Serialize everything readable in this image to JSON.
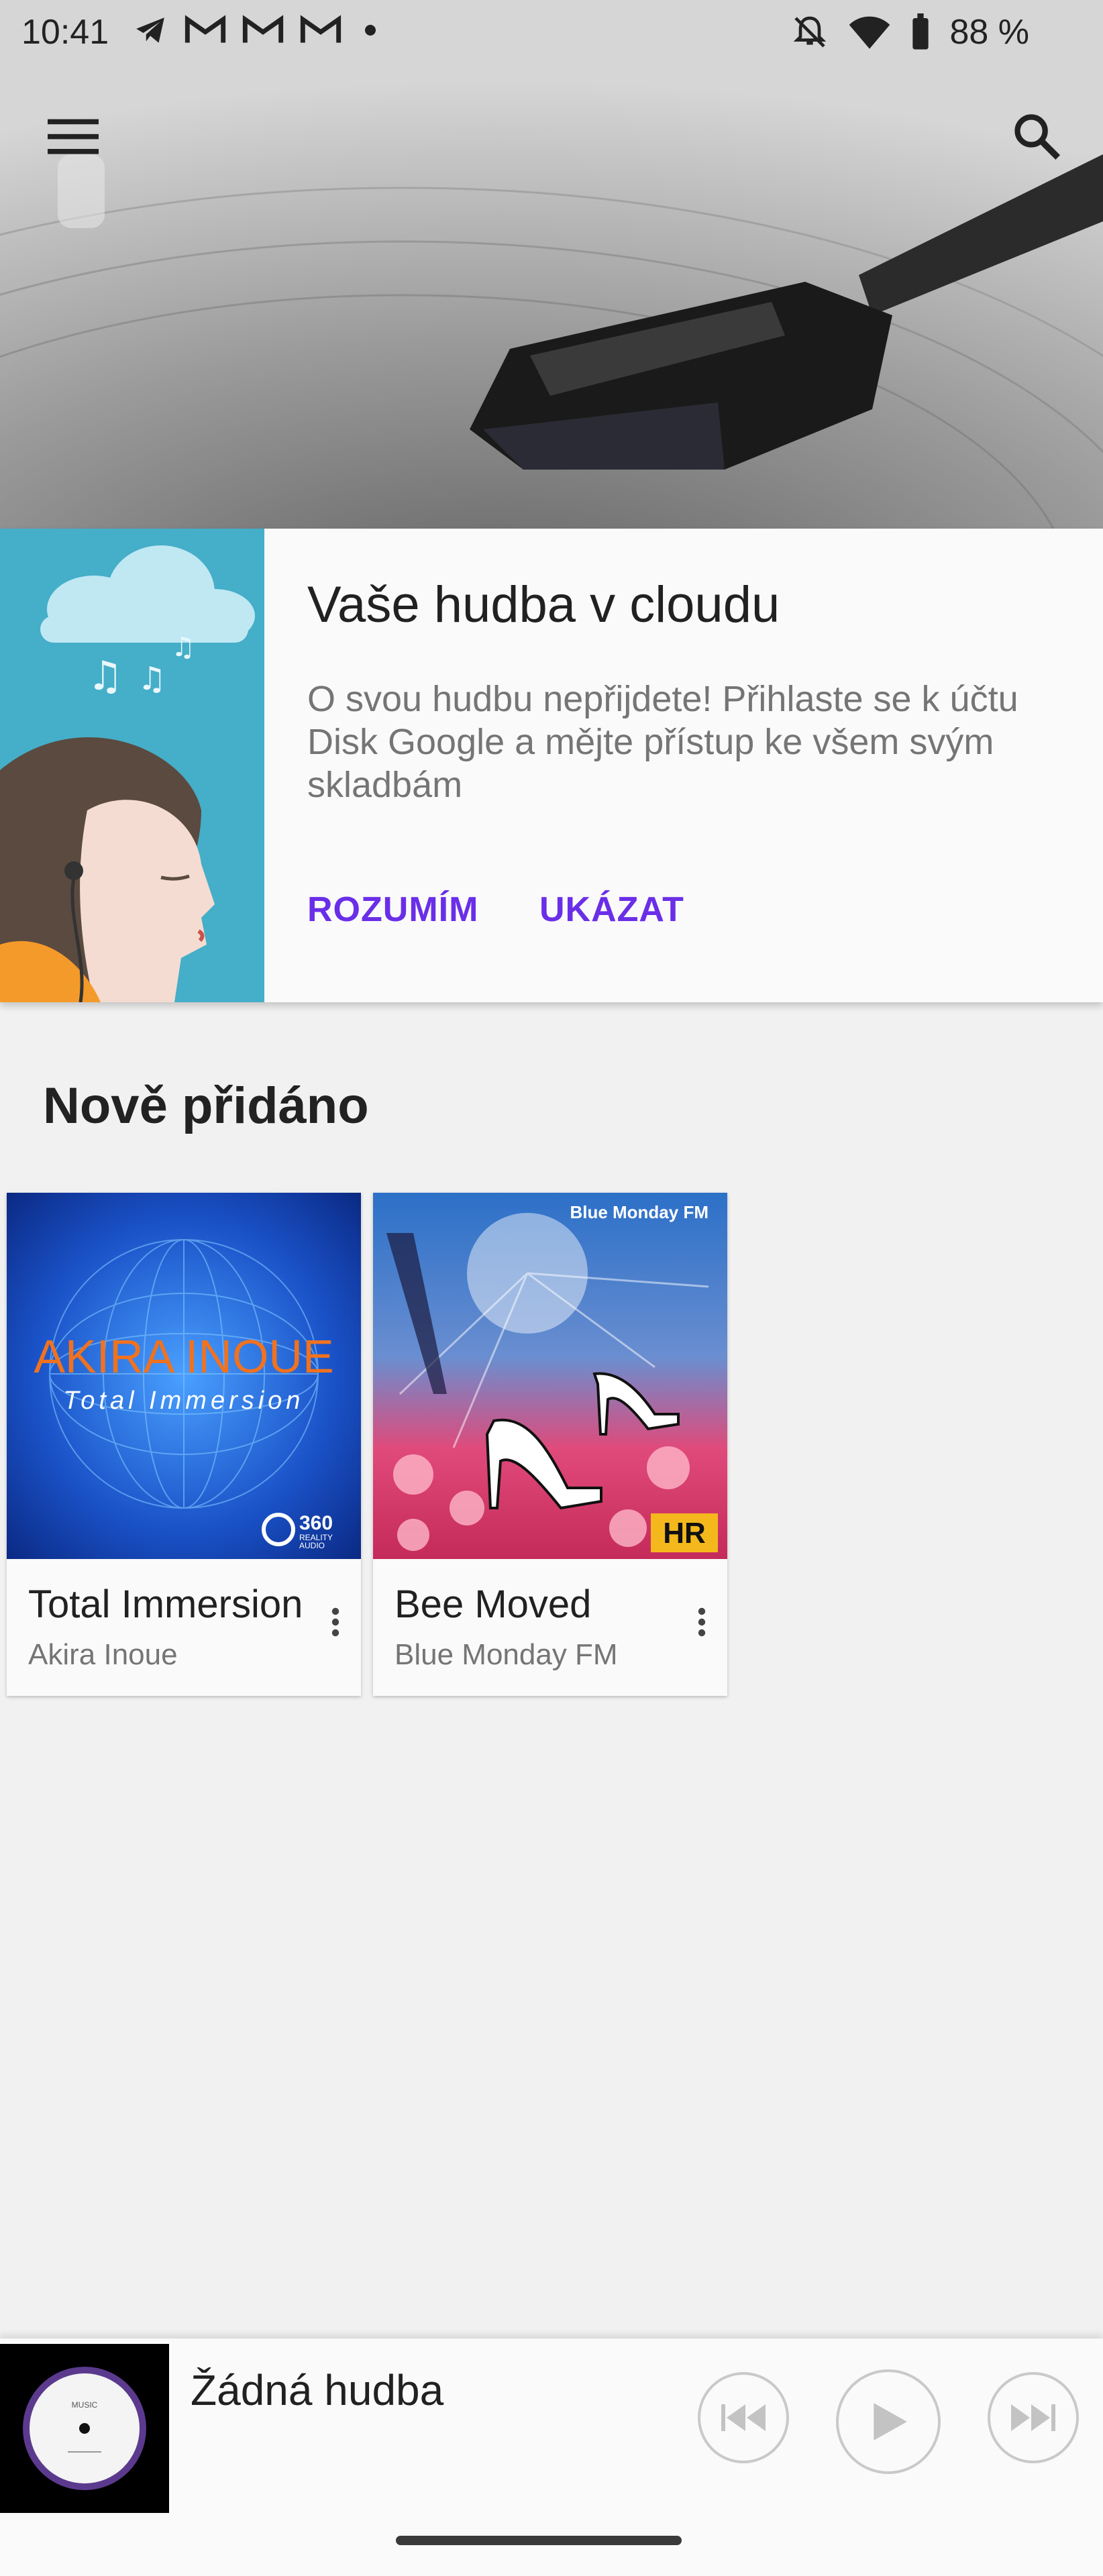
{
  "status_bar": {
    "time": "10:41",
    "battery": "88 %",
    "notification_icons": [
      "telegram-icon",
      "gmail-icon",
      "gmail-icon",
      "gmail-icon",
      "dot-icon"
    ],
    "system_icons": [
      "bell-off-icon",
      "wifi-icon",
      "battery-icon"
    ]
  },
  "header": {
    "menu_icon": "hamburger-menu-icon",
    "search_icon": "search-icon"
  },
  "banner": {
    "title": "Vaše hudba v cloudu",
    "body": "O svou hudbu nepřijdete! Přihlaste se k účtu Disk Google a mějte přístup ke všem svým skladbám",
    "buttons": [
      "ROZUMÍM",
      "UKÁZAT"
    ],
    "accent": "#6a2ee8",
    "art_bg": "#45aec8"
  },
  "section": {
    "title": "Nově přidáno"
  },
  "albums": [
    {
      "title": "Total Immersion",
      "artist": "Akira Inoue",
      "cover_line1": "AKIRA INOUE",
      "cover_line2": "Total Immersion",
      "badge_num": "360",
      "badge_text1": "REALITY",
      "badge_text2": "AUDIO"
    },
    {
      "title": "Bee Moved",
      "artist": "Blue Monday FM",
      "cover_line1": "Blue Monday FM",
      "badge": "HR"
    }
  ],
  "player": {
    "title": "Žádná hudba",
    "disc_label": "MUSIC",
    "controls": [
      "previous-icon",
      "play-icon",
      "next-icon"
    ]
  }
}
